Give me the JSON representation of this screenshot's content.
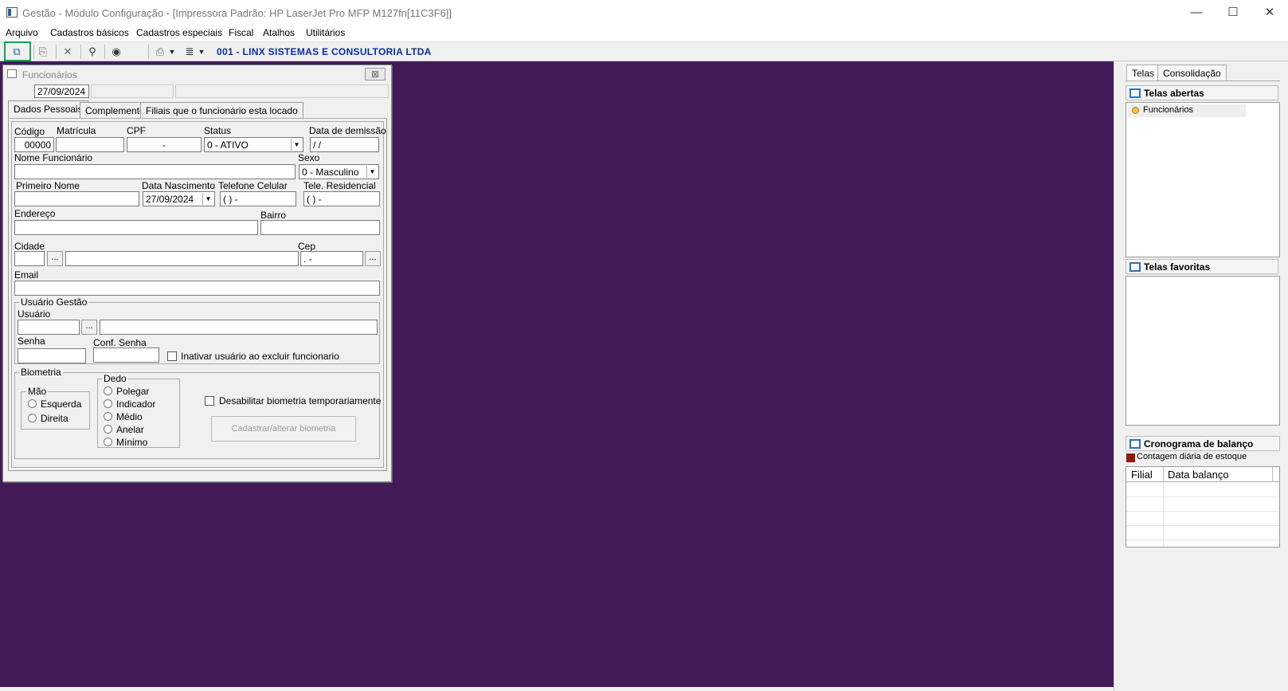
{
  "window": {
    "title": "Gestão - Módulo Configuração - [Impressora Padrão: HP LaserJet Pro MFP M127fn[11C3F6]]",
    "minimize": "—",
    "maximize": "☐",
    "close": "✕"
  },
  "menu": [
    "Arquivo",
    "Cadastros básicos",
    "Cadastros especiais",
    "Fiscal",
    "Atalhos",
    "Utilitários"
  ],
  "toolbar": {
    "company": "001 - LINX SISTEMAS E CONSULTORIA LTDA"
  },
  "child": {
    "title": "Funcionários",
    "close_glyph": "⊠",
    "date": "27/09/2024",
    "tabs": [
      "Dados Pessoais",
      "Complemento",
      "Filiais que o funcionário esta locado"
    ],
    "labels": {
      "codigo": "Código",
      "matricula": "Matrícula",
      "cpf": "CPF",
      "status": "Status",
      "demissao": "Data de demissão",
      "nome": "Nome Funcionário",
      "sexo": "Sexo",
      "primeiro": "Primeiro Nome",
      "nascimento": "Data Nascimento",
      "celular": "Telefone Celular",
      "residencial": "Tele. Residencial",
      "endereco": "Endereço",
      "bairro": "Bairro",
      "cidade": "Cidade",
      "cep": "Cep",
      "email": "Email",
      "usuario_gestao": "Usuário Gestão",
      "usuario": "Usuário",
      "senha": "Senha",
      "conf_senha": "Conf. Senha",
      "inativar": "Inativar usuário ao excluir funcionario",
      "biometria": "Biometria",
      "mao": "Mão",
      "dedo": "Dedo",
      "desabilitar": "Desabilitar biometria temporariamente",
      "cadastrar": "Cadastrar/alterar biometria"
    },
    "values": {
      "codigo": "00000",
      "cpf": "   -",
      "status": "0 - ATIVO",
      "demissao": " /  /",
      "sexo": "0 - Masculino",
      "nascimento": "27/09/2024",
      "celular": "(  )      -",
      "residencial": "(  )      -",
      "cep": " .   -",
      "ellipsis": "..."
    },
    "mao_options": [
      "Esquerda",
      "Direita"
    ],
    "dedo_options": [
      "Polegar",
      "Indicador",
      "Médio",
      "Anelar",
      "Mínimo"
    ]
  },
  "right": {
    "tabs": [
      "Telas",
      "Consolidação"
    ],
    "abertas": "Telas abertas",
    "open_item": "Funcionários",
    "favoritas": "Telas favoritas",
    "cronograma": "Cronograma de balanço",
    "legend": "Contagem diária de estoque",
    "grid_headers": [
      "Filial",
      "Data balanço"
    ]
  },
  "colors": {
    "workspace": "#421a58",
    "company": "#0a2d9e",
    "legend": "#8b1a12",
    "highlight": "#1e9e55"
  }
}
